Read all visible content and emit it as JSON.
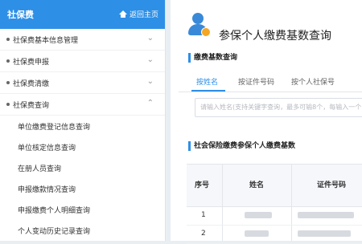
{
  "sidebar": {
    "title": "社保费",
    "home_link": "返回主页",
    "menu": [
      {
        "label": "社保费基本信息管理",
        "chevron": "⌄"
      },
      {
        "label": "社保费申报",
        "chevron": "⌄"
      },
      {
        "label": "社保费清缴",
        "chevron": "⌄"
      },
      {
        "label": "社保费查询",
        "chevron": "⌃"
      }
    ],
    "submenu": [
      "单位缴费登记信息查询",
      "单位核定信息查询",
      "在册人员查询",
      "申报缴款情况查询",
      "申报缴费个人明细查询",
      "个人变动历史记录查询"
    ]
  },
  "main": {
    "page_title": "参保个人缴费基数查询",
    "section_query": "缴费基数查询",
    "tabs": [
      "按姓名",
      "按证件号码",
      "按个人社保号"
    ],
    "active_tab": 0,
    "search_placeholder": "请输入姓名(支持关键字查询，最多可输8个，每输入一个",
    "section_result": "社会保险缴费参保个人缴费基数",
    "table": {
      "headers": [
        "序号",
        "姓名",
        "证件号码"
      ],
      "rows": [
        {
          "index": "1"
        },
        {
          "index": "2"
        }
      ]
    }
  },
  "colors": {
    "accent": "#2e8fe6",
    "header_bg": "#2e8fe6"
  }
}
